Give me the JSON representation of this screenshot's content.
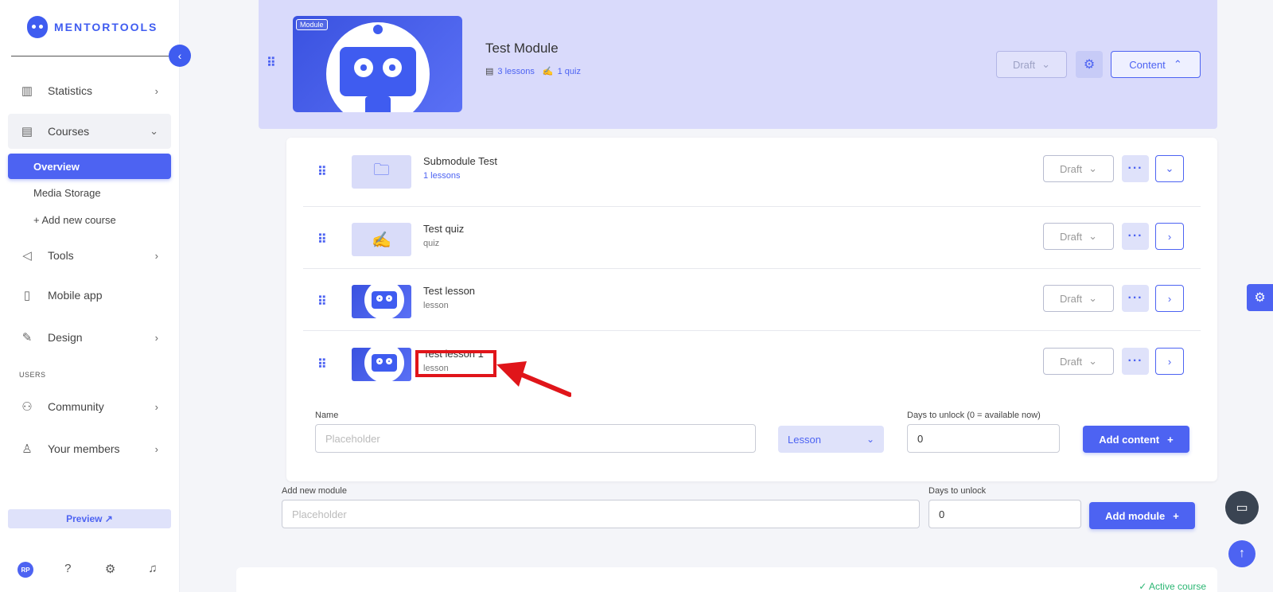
{
  "brand": {
    "name": "MENTORTOOLS"
  },
  "sidebar": {
    "items": [
      {
        "label": "Statistics",
        "icon": "bar-chart-icon"
      },
      {
        "label": "Courses",
        "icon": "book-icon"
      },
      {
        "label": "Tools",
        "icon": "megaphone-icon"
      },
      {
        "label": "Mobile app",
        "icon": "phone-icon"
      },
      {
        "label": "Design",
        "icon": "pencil-icon"
      },
      {
        "label": "Community",
        "icon": "people-icon"
      },
      {
        "label": "Your members",
        "icon": "person-icon"
      }
    ],
    "course_subitems": [
      "Overview",
      "Media Storage",
      "+ Add new course"
    ],
    "section_users": "USERS",
    "preview_label": "Preview ↗",
    "avatar_initials": "RP"
  },
  "module": {
    "tag": "Module",
    "title": "Test Module",
    "lessons_count": "3 lessons",
    "quiz_count": "1 quiz",
    "status": "Draft",
    "content_button": "Content"
  },
  "content_rows": [
    {
      "title": "Submodule Test",
      "subtitle": "1 lessons",
      "type": "folder",
      "status": "Draft"
    },
    {
      "title": "Test quiz",
      "subtitle": "quiz",
      "type": "quiz",
      "status": "Draft"
    },
    {
      "title": "Test lesson",
      "subtitle": "lesson",
      "type": "lesson",
      "status": "Draft"
    },
    {
      "title": "Test lesson 1",
      "subtitle": "lesson",
      "type": "lesson",
      "status": "Draft"
    }
  ],
  "add_content_form": {
    "name_label": "Name",
    "name_placeholder": "Placeholder",
    "type_value": "Lesson",
    "days_label": "Days to unlock (0 = available now)",
    "days_value": "0",
    "submit_label": "Add content"
  },
  "add_module_form": {
    "name_label": "Add new module",
    "name_placeholder": "Placeholder",
    "days_label": "Days to unlock",
    "days_value": "0",
    "submit_label": "Add module"
  },
  "footer": {
    "status": "Active course"
  },
  "colors": {
    "accent": "#4d63f2",
    "highlight": "#e0151a",
    "module_bg": "#d9dafb",
    "success": "#2bb673"
  }
}
